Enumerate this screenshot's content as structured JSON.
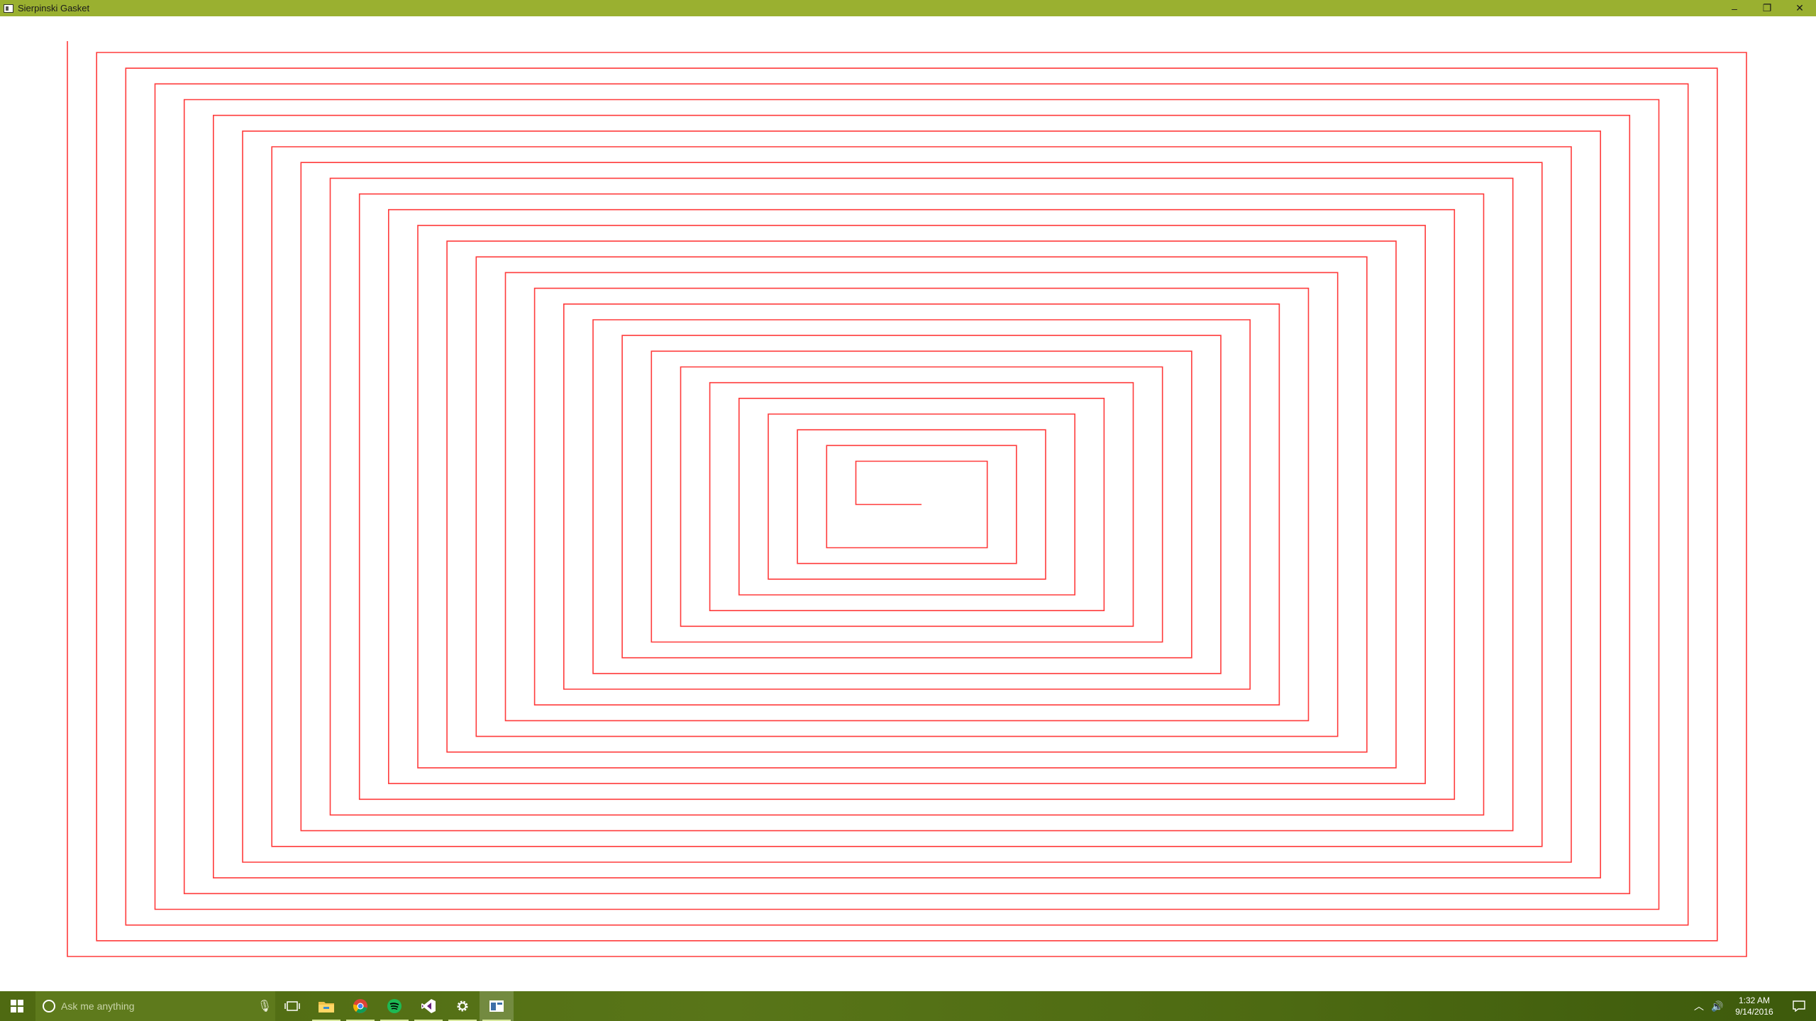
{
  "window": {
    "title": "Sierpinski Gasket",
    "controls": {
      "minimize": "–",
      "restore": "❐",
      "close": "✕"
    }
  },
  "drawing": {
    "stroke_color": "#ff3b3b",
    "background": "#ffffff",
    "shape": "rectangular spiral",
    "turns": 27
  },
  "taskbar": {
    "search_placeholder": "Ask me anything",
    "pinned": [
      {
        "name": "file-explorer-icon",
        "color": "#f2c14a"
      },
      {
        "name": "chrome-icon",
        "color": "#db4437"
      },
      {
        "name": "spotify-icon",
        "color": "#1db954"
      },
      {
        "name": "visual-studio-icon",
        "color": "#68217a"
      },
      {
        "name": "settings-icon",
        "color": "#ffffff"
      },
      {
        "name": "app-window-icon",
        "color": "#3d6fa8"
      }
    ],
    "clock": {
      "time": "1:32 AM",
      "date": "9/14/2016"
    }
  }
}
